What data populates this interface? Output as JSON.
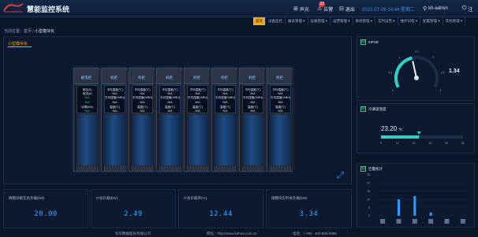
{
  "header": {
    "app_title": "慧能监控系统",
    "actions": [
      {
        "icon": "broadcast-icon",
        "label": "声光"
      },
      {
        "icon": "warning-icon",
        "label": "告警",
        "badge": "23"
      },
      {
        "icon": "exit-icon",
        "label": "退出"
      }
    ],
    "date": "2021-07-06 14:44 星期二",
    "user": {
      "icon": "user-icon",
      "label": "kh-admin"
    },
    "exit_short": "注",
    "brand_color": "#e53935",
    "accent_color": "#f5a623"
  },
  "nav": {
    "items": [
      {
        "label": "首页",
        "active": true
      },
      {
        "label": "设备监控",
        "active": false
      },
      {
        "label": "报表管理 ▾",
        "active": false
      },
      {
        "label": "设备管理 ▾",
        "active": false
      },
      {
        "label": "运营管理 ▾",
        "active": false
      },
      {
        "label": "系统管理 ▾",
        "active": false
      },
      {
        "label": "实时运营 ▾",
        "active": false
      },
      {
        "label": "维护日程 ▾",
        "active": false
      },
      {
        "label": "配置管理 ▾",
        "active": false
      },
      {
        "label": "其他管理 ▾",
        "active": false
      }
    ]
  },
  "breadcrumb": {
    "prefix": "当前位置：首页 /",
    "current": "小型模块化"
  },
  "main": {
    "title": "小型模块化",
    "racks": [
      {
        "name": "配电柜",
        "rows": [
          "电压(V)",
          "电流(A)",
          "N/A",
          "N/A",
          "功率(kW)",
          "N/A"
        ]
      },
      {
        "name": "机柜",
        "rows": [
          "平均温度(℃)",
          "N/A",
          "平均湿度(%RH)",
          "N/A",
          "温度(℃)",
          "N/A"
        ]
      },
      {
        "name": "机柜",
        "rows": [
          "平均温度(℃)",
          "N/A",
          "平均湿度(%RH)",
          "N/A",
          "温度(℃)",
          "N/A"
        ]
      },
      {
        "name": "机柜",
        "rows": [
          "平均温度(℃)",
          "N/A",
          "平均湿度(%RH)",
          "N/A",
          "温度(℃)",
          "N/A"
        ]
      },
      {
        "name": "机柜",
        "rows": [
          "平均温度(℃)",
          "N/A",
          "平均湿度(%RH)",
          "N/A",
          "温度(℃)",
          "N/A"
        ]
      },
      {
        "name": "机柜",
        "rows": [
          "平均温度(℃)",
          "N/A",
          "平均湿度(%RH)",
          "N/A",
          "温度(℃)",
          "N/A"
        ]
      },
      {
        "name": "机柜",
        "rows": [
          "平均温度(℃)",
          "N/A",
          "平均湿度(%RH)",
          "N/A",
          "温度(℃)",
          "N/A"
        ]
      },
      {
        "name": "机柜",
        "rows": [
          "平均温度(℃)",
          "N/A",
          "平均湿度(%RH)",
          "N/A",
          "温度(℃)",
          "N/A"
        ]
      }
    ],
    "expand_icon": "expand-icon"
  },
  "stats": [
    {
      "label": "微模块额定总负载(kW)",
      "value": "20.00"
    },
    {
      "label": "IT总负载(kW)",
      "value": "2.49"
    },
    {
      "label": "IT总负载率(%)",
      "value": "12.44"
    },
    {
      "label": "微模块实时总负载(kW)",
      "value": "3.34"
    }
  ],
  "footer": {
    "company": "科华数据股份有限公司",
    "website": "网址：http://www.kehua.com.cn",
    "phone": "电话：（+86）400-808-9986"
  },
  "pue": {
    "title": "mPUE",
    "value": "1.34",
    "ticks": [
      "0.5",
      "1",
      "1.5",
      "2",
      "2.5",
      "3",
      "0"
    ],
    "scale_min": 0,
    "scale_max": 3,
    "level": 1.34
  },
  "temp": {
    "title": "冷通道温度",
    "value": "23.20",
    "unit": "℃",
    "ticks": [
      "0",
      "10",
      "20",
      "30",
      "40",
      "50"
    ],
    "scale_min": 0,
    "scale_max": 50,
    "level": 23.2
  },
  "alarm": {
    "title": "告警统计",
    "chart_data": {
      "type": "bar",
      "categories": [
        "",
        "",
        "",
        "",
        "",
        ""
      ],
      "values": [
        0,
        10,
        12,
        2,
        0,
        0
      ],
      "ylim": [
        0,
        25
      ],
      "yticks": [
        "25",
        "20",
        "15",
        "10",
        "5",
        "0"
      ]
    }
  }
}
